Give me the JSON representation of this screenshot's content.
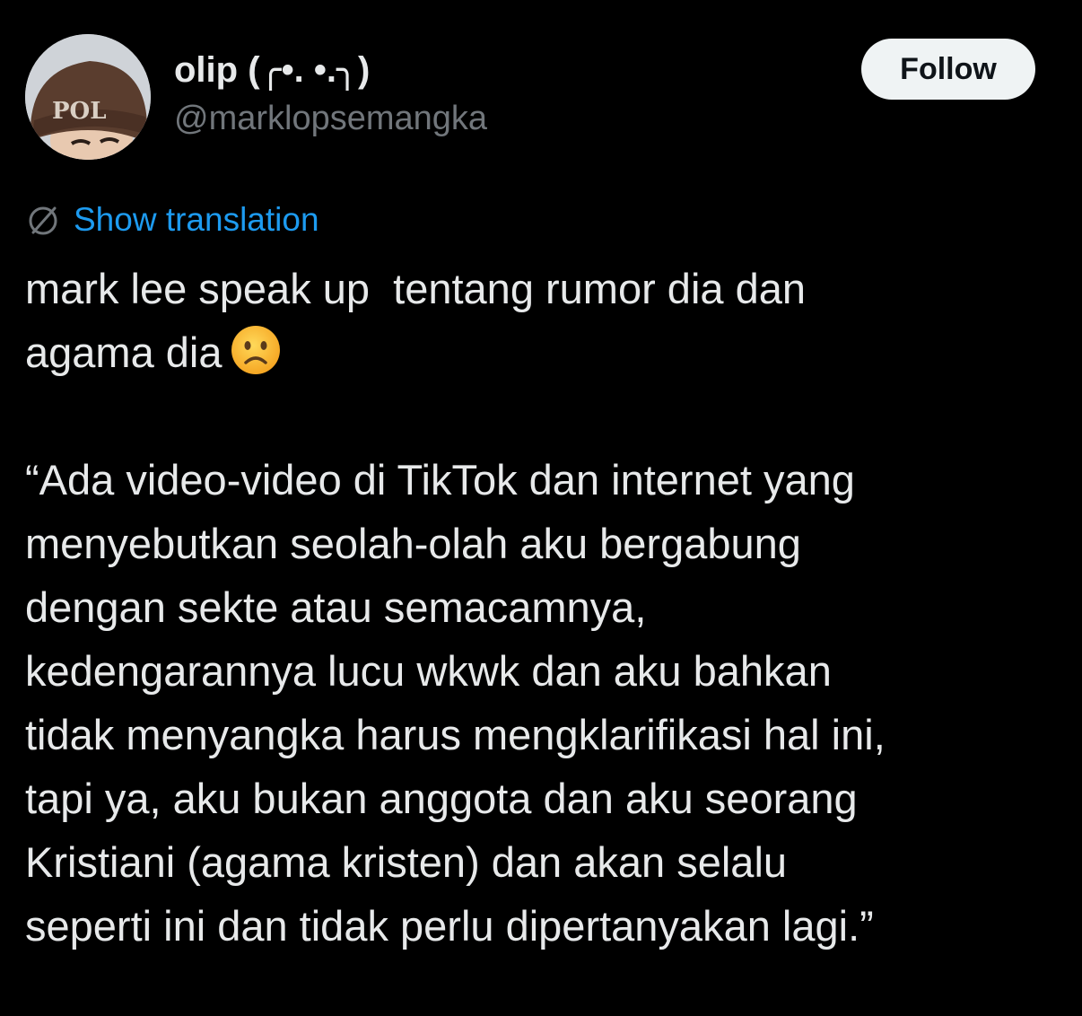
{
  "author": {
    "display_name": "olip (╭•. •.╮)",
    "handle": "@marklopsemangka",
    "avatar_hat_text": "POL"
  },
  "follow_label": "Follow",
  "translation_label": "Show translation",
  "tweet": {
    "intro": "mark lee speak up  tentang rumor dia dan\nagama dia",
    "intro_emoji": "frowning-face-emoji",
    "quote": "“Ada video-video di TikTok dan internet yang\nmenyebutkan seolah-olah aku bergabung\ndengan sekte atau semacamnya,\nkedengarannya lucu wkwk dan aku bahkan\ntidak menyangka harus mengklarifikasi hal ini,\ntapi ya, aku bukan anggota dan aku seorang\nKristiani (agama kristen) dan akan selalu\nseperti ini dan tidak perlu dipertanyakan lagi.”"
  },
  "colors": {
    "background": "#000000",
    "text_primary": "#e7e9ea",
    "text_secondary": "#71767b",
    "link_blue": "#1d9bf0",
    "follow_bg": "#eff3f4"
  }
}
